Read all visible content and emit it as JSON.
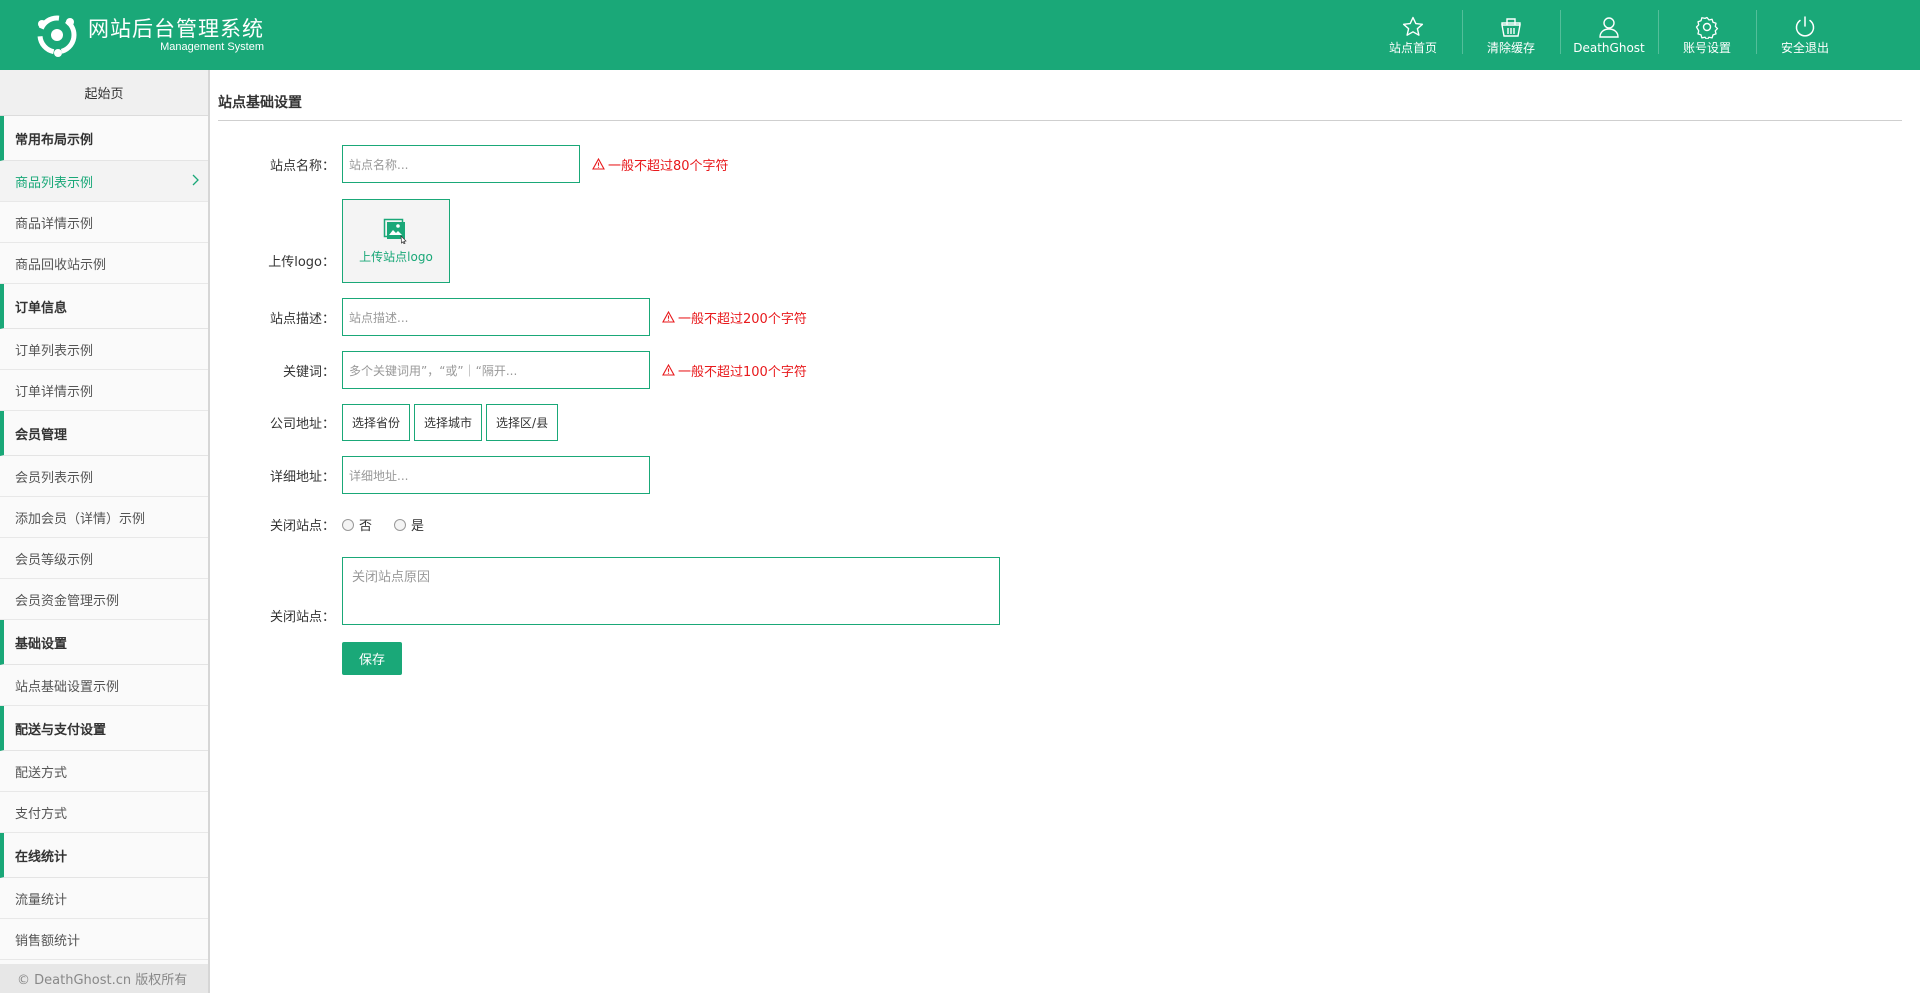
{
  "header": {
    "title": "网站后台管理系统",
    "subtitle": "Management System",
    "nav": [
      {
        "icon": "star-icon",
        "label": "站点首页"
      },
      {
        "icon": "basket-icon",
        "label": "清除缓存"
      },
      {
        "icon": "user-icon",
        "label": "DeathGhost"
      },
      {
        "icon": "gear-icon",
        "label": "账号设置"
      },
      {
        "icon": "power-icon",
        "label": "安全退出"
      }
    ]
  },
  "sidebar": {
    "home": "起始页",
    "groups": [
      {
        "title": "常用布局示例",
        "items": [
          "商品列表示例",
          "商品详情示例",
          "商品回收站示例"
        ]
      },
      {
        "title": "订单信息",
        "items": [
          "订单列表示例",
          "订单详情示例"
        ]
      },
      {
        "title": "会员管理",
        "items": [
          "会员列表示例",
          "添加会员（详情）示例",
          "会员等级示例",
          "会员资金管理示例"
        ]
      },
      {
        "title": "基础设置",
        "items": [
          "站点基础设置示例"
        ]
      },
      {
        "title": "配送与支付设置",
        "items": [
          "配送方式",
          "支付方式"
        ]
      },
      {
        "title": "在线统计",
        "items": [
          "流量统计",
          "销售额统计"
        ]
      }
    ],
    "active_item": "商品列表示例",
    "footer": "© DeathGhost.cn 版权所有"
  },
  "form": {
    "page_title": "站点基础设置",
    "site_name": {
      "label": "站点名称：",
      "placeholder": "站点名称...",
      "hint": "一般不超过80个字符"
    },
    "logo": {
      "label": "上传logo：",
      "button": "上传站点logo"
    },
    "description": {
      "label": "站点描述：",
      "placeholder": "站点描述...",
      "hint": "一般不超过200个字符"
    },
    "keywords": {
      "label": "关键词：",
      "placeholder": "多个关键词用”，“或”｜“隔开...",
      "hint": "一般不超过100个字符"
    },
    "address": {
      "label": "公司地址：",
      "province": "选择省份",
      "city": "选择城市",
      "district": "选择区/县"
    },
    "detail_address": {
      "label": "详细地址：",
      "placeholder": "详细地址..."
    },
    "close_site": {
      "label": "关闭站点：",
      "options": [
        "否",
        "是"
      ]
    },
    "close_reason": {
      "label": "关闭站点：",
      "placeholder": "关闭站点原因"
    },
    "save": "保存"
  },
  "colors": {
    "brand": "#1aa878",
    "warning": "#e8191c"
  }
}
